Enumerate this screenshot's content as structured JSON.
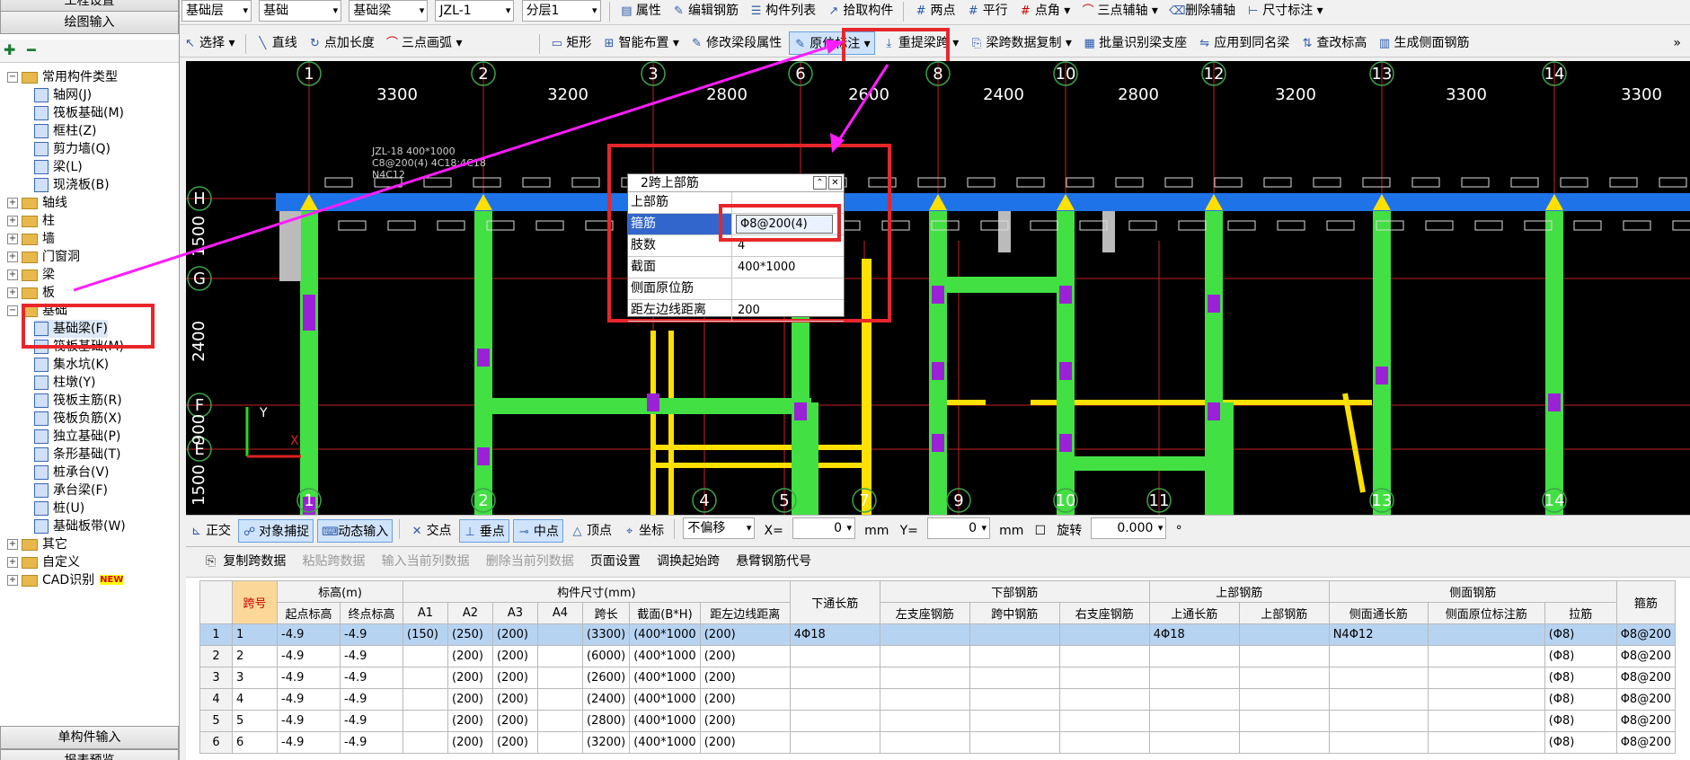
{
  "left_panel": {
    "top_buttons": [
      "工程设置",
      "绘图输入"
    ],
    "bottom_buttons": [
      "单构件输入",
      "报表预览"
    ],
    "tree": [
      {
        "label": "常用构件类型",
        "level": 0,
        "expanded": true,
        "type": "folder"
      },
      {
        "label": "轴网(J)",
        "level": 1,
        "type": "item"
      },
      {
        "label": "筏板基础(M)",
        "level": 1,
        "type": "item"
      },
      {
        "label": "框柱(Z)",
        "level": 1,
        "type": "item"
      },
      {
        "label": "剪力墙(Q)",
        "level": 1,
        "type": "item"
      },
      {
        "label": "梁(L)",
        "level": 1,
        "type": "item"
      },
      {
        "label": "现浇板(B)",
        "level": 1,
        "type": "item"
      },
      {
        "label": "轴线",
        "level": 0,
        "expanded": false,
        "type": "folder"
      },
      {
        "label": "柱",
        "level": 0,
        "expanded": false,
        "type": "folder"
      },
      {
        "label": "墙",
        "level": 0,
        "expanded": false,
        "type": "folder"
      },
      {
        "label": "门窗洞",
        "level": 0,
        "expanded": false,
        "type": "folder"
      },
      {
        "label": "梁",
        "level": 0,
        "expanded": false,
        "type": "folder"
      },
      {
        "label": "板",
        "level": 0,
        "expanded": false,
        "type": "folder"
      },
      {
        "label": "基础",
        "level": 0,
        "expanded": true,
        "type": "folder"
      },
      {
        "label": "基础梁(F)",
        "level": 1,
        "type": "item",
        "selected": true
      },
      {
        "label": "筏板基础(M)",
        "level": 1,
        "type": "item"
      },
      {
        "label": "集水坑(K)",
        "level": 1,
        "type": "item"
      },
      {
        "label": "柱墩(Y)",
        "level": 1,
        "type": "item"
      },
      {
        "label": "筏板主筋(R)",
        "level": 1,
        "type": "item"
      },
      {
        "label": "筏板负筋(X)",
        "level": 1,
        "type": "item"
      },
      {
        "label": "独立基础(P)",
        "level": 1,
        "type": "item"
      },
      {
        "label": "条形基础(T)",
        "level": 1,
        "type": "item"
      },
      {
        "label": "桩承台(V)",
        "level": 1,
        "type": "item"
      },
      {
        "label": "承台梁(F)",
        "level": 1,
        "type": "item"
      },
      {
        "label": "桩(U)",
        "level": 1,
        "type": "item"
      },
      {
        "label": "基础板带(W)",
        "level": 1,
        "type": "item"
      },
      {
        "label": "其它",
        "level": 0,
        "expanded": false,
        "type": "folder"
      },
      {
        "label": "自定义",
        "level": 0,
        "expanded": false,
        "type": "folder"
      },
      {
        "label": "CAD识别",
        "level": 0,
        "expanded": false,
        "type": "folder",
        "badge": "NEW"
      }
    ]
  },
  "toolbar1": {
    "floor": "基础层",
    "category": "基础",
    "type": "基础梁",
    "component": "JZL-1",
    "layer": "分层1",
    "buttons": [
      "属性",
      "编辑钢筋",
      "构件列表",
      "拾取构件",
      "两点",
      "平行",
      "点角",
      "三点辅轴",
      "删除辅轴",
      "尺寸标注"
    ]
  },
  "toolbar2": {
    "select": "选择",
    "buttons_a": [
      "直线",
      "点加长度",
      "三点画弧"
    ],
    "buttons_b": [
      "矩形",
      "智能布置",
      "修改梁段属性",
      "原位标注",
      "重提梁跨",
      "梁跨数据复制",
      "批量识别梁支座",
      "应用到同名梁",
      "查改标高",
      "生成侧面钢筋"
    ]
  },
  "canvas": {
    "top_axes": [
      "1",
      "2",
      "3",
      "6",
      "8",
      "10",
      "12",
      "13",
      "14"
    ],
    "top_dims": [
      "3300",
      "3200",
      "2800",
      "2600",
      "2400",
      "2800",
      "3200",
      "3300",
      "3300"
    ],
    "bottom_axes": [
      "1",
      "2",
      "4",
      "5",
      "7",
      "9",
      "10",
      "11",
      "13",
      "14"
    ],
    "left_axes": [
      "H",
      "G",
      "F",
      "E"
    ],
    "left_dims": [
      "1500",
      "2400",
      "900",
      "1500"
    ],
    "beam_label": [
      "JZL-18  400*1000",
      "C8@200(4) 4C18;4C18",
      "N4C12"
    ],
    "colors": {
      "background": "#000000",
      "beam": "#1e73e8",
      "column": "#42e043",
      "rebar": "#ffe000",
      "support": "#9b21d6"
    }
  },
  "popup": {
    "title": "2跨上部筋",
    "rows": [
      {
        "key": "上部筋",
        "value": ""
      },
      {
        "key": "箍筋",
        "value": "Φ8@200(4)"
      },
      {
        "key": "肢数",
        "value": "4"
      },
      {
        "key": "截面",
        "value": "400*1000"
      },
      {
        "key": "侧面原位筋",
        "value": ""
      },
      {
        "key": "距左边线距离",
        "value": "200"
      }
    ]
  },
  "status_bar": {
    "buttons": [
      "正交",
      "对象捕捉",
      "动态输入",
      "交点",
      "垂点",
      "中点",
      "顶点",
      "坐标"
    ],
    "offset_mode": "不偏移",
    "x_label": "X=",
    "x_value": "0",
    "y_label": "Y=",
    "y_value": "0",
    "unit": "mm",
    "rotate_label": "旋转",
    "rotate_value": "0.000",
    "degree": "°"
  },
  "bottom_toolbar": [
    "复制跨数据",
    "粘贴跨数据",
    "输入当前列数据",
    "删除当前列数据",
    "页面设置",
    "调换起始跨",
    "悬臂钢筋代号"
  ],
  "grid": {
    "group_headers": [
      "跨号",
      "标高(m)",
      "构件尺寸(mm)",
      "下通长筋",
      "下部钢筋",
      "上部钢筋",
      "侧面钢筋",
      "箍筋"
    ],
    "sub_headers": [
      "起点标高",
      "终点标高",
      "A1",
      "A2",
      "A3",
      "A4",
      "跨长",
      "截面(B*H)",
      "距左边线距离",
      "左支座钢筋",
      "跨中钢筋",
      "右支座钢筋",
      "上通长筋",
      "上部钢筋",
      "侧面通长筋",
      "侧面原位标注筋",
      "拉筋"
    ],
    "rows": [
      {
        "n": "1",
        "span": "1",
        "start": "-4.9",
        "end": "-4.9",
        "a1": "(150)",
        "a2": "(250)",
        "a3": "(200)",
        "a4": "",
        "len": "(3300)",
        "sec": "(400*1000",
        "dist": "(200)",
        "btm": "4Φ18",
        "ls": "",
        "mid": "",
        "rs": "",
        "top": "4Φ18",
        "tops": "",
        "side": "N4Φ12",
        "sidep": "",
        "tie": "(Φ8)",
        "stir": "Φ8@200"
      },
      {
        "n": "2",
        "span": "2",
        "start": "-4.9",
        "end": "-4.9",
        "a1": "",
        "a2": "(200)",
        "a3": "(200)",
        "a4": "",
        "len": "(6000)",
        "sec": "(400*1000",
        "dist": "(200)",
        "btm": "",
        "ls": "",
        "mid": "",
        "rs": "",
        "top": "",
        "tops": "",
        "side": "",
        "sidep": "",
        "tie": "(Φ8)",
        "stir": "Φ8@200"
      },
      {
        "n": "3",
        "span": "3",
        "start": "-4.9",
        "end": "-4.9",
        "a1": "",
        "a2": "(200)",
        "a3": "(200)",
        "a4": "",
        "len": "(2600)",
        "sec": "(400*1000",
        "dist": "(200)",
        "btm": "",
        "ls": "",
        "mid": "",
        "rs": "",
        "top": "",
        "tops": "",
        "side": "",
        "sidep": "",
        "tie": "(Φ8)",
        "stir": "Φ8@200"
      },
      {
        "n": "4",
        "span": "4",
        "start": "-4.9",
        "end": "-4.9",
        "a1": "",
        "a2": "(200)",
        "a3": "(200)",
        "a4": "",
        "len": "(2400)",
        "sec": "(400*1000",
        "dist": "(200)",
        "btm": "",
        "ls": "",
        "mid": "",
        "rs": "",
        "top": "",
        "tops": "",
        "side": "",
        "sidep": "",
        "tie": "(Φ8)",
        "stir": "Φ8@200"
      },
      {
        "n": "5",
        "span": "5",
        "start": "-4.9",
        "end": "-4.9",
        "a1": "",
        "a2": "(200)",
        "a3": "(200)",
        "a4": "",
        "len": "(2800)",
        "sec": "(400*1000",
        "dist": "(200)",
        "btm": "",
        "ls": "",
        "mid": "",
        "rs": "",
        "top": "",
        "tops": "",
        "side": "",
        "sidep": "",
        "tie": "(Φ8)",
        "stir": "Φ8@200"
      },
      {
        "n": "6",
        "span": "6",
        "start": "-4.9",
        "end": "-4.9",
        "a1": "",
        "a2": "(200)",
        "a3": "(200)",
        "a4": "",
        "len": "(3200)",
        "sec": "(400*1000",
        "dist": "(200)",
        "btm": "",
        "ls": "",
        "mid": "",
        "rs": "",
        "top": "",
        "tops": "",
        "side": "",
        "sidep": "",
        "tie": "(Φ8)",
        "stir": "Φ8@200"
      }
    ]
  }
}
